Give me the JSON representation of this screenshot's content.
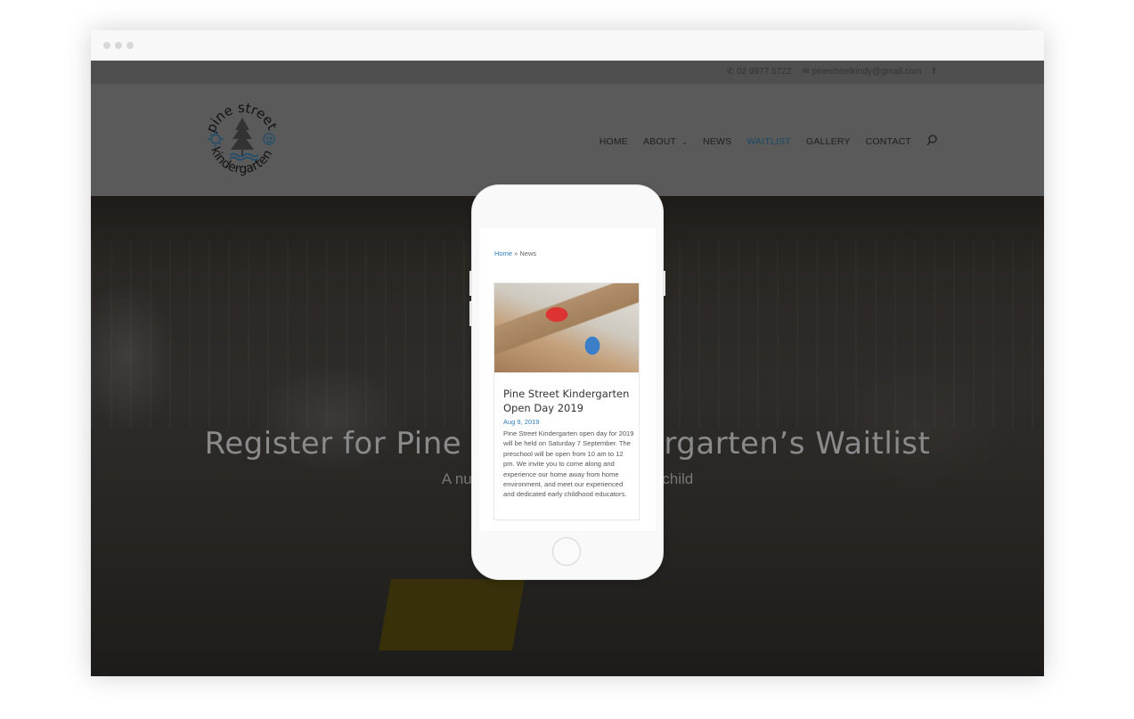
{
  "browser": {
    "window_controls": [
      "close",
      "minimize",
      "maximize"
    ]
  },
  "topbar": {
    "phone": "02 9977 5722",
    "phone_icon": "phone-icon",
    "email": "pinestreetkindy@gmail.com",
    "email_icon": "envelope-icon",
    "social_icon": "facebook-icon",
    "social_glyph": "f"
  },
  "header": {
    "logo": {
      "top_text": "pine street",
      "bottom_text": "kindergarten"
    },
    "nav": [
      {
        "label": "HOME",
        "active": false
      },
      {
        "label": "ABOUT",
        "active": false,
        "has_dropdown": true
      },
      {
        "label": "NEWS",
        "active": false
      },
      {
        "label": "WAITLIST",
        "active": true
      },
      {
        "label": "GALLERY",
        "active": false
      },
      {
        "label": "CONTACT",
        "active": false
      }
    ],
    "search_icon": "search-icon",
    "colors": {
      "active_nav": "#1b4966"
    }
  },
  "hero": {
    "title": "Register for Pine Street Kindergarten’s Waitlist",
    "subtitle": "A nurturing environment for your child"
  },
  "phone": {
    "breadcrumb": {
      "home": "Home",
      "separator": "»",
      "current": "News"
    },
    "post": {
      "title": "Pine Street Kindergarten Open Day 2019",
      "date": "Aug 9, 2019",
      "excerpt": "Pine Street Kindergarten open day for 2019 will be held on Saturday 7 September. The preschool will be open from 10 am to 12 pm. We invite you to come along and experience our home away from home environment, and meet our experienced and dedicated early childhood educators."
    },
    "colors": {
      "link": "#2e7fbf"
    }
  }
}
